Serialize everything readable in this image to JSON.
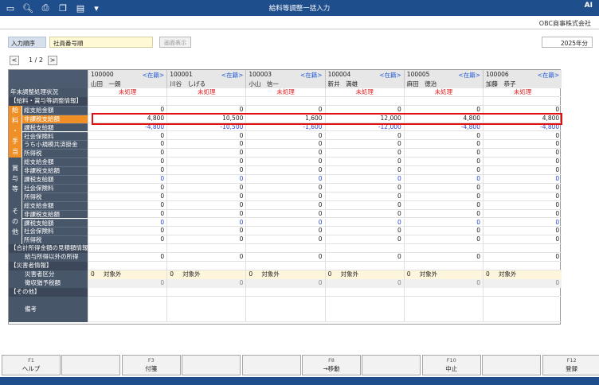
{
  "window": {
    "title": "給料等調整一括入力",
    "logo": "AI"
  },
  "company": "OBC商事株式会社",
  "filter": {
    "order_label": "入力順序",
    "order_value": "社員番号順",
    "display_button": "画面表示",
    "year": "2025年分"
  },
  "pager": {
    "prev": "<",
    "next": ">",
    "page": "1 / 2"
  },
  "employees": [
    {
      "code": "100000",
      "name": "山田　一朗",
      "status": "<在籍>"
    },
    {
      "code": "100001",
      "name": "川谷　しげる",
      "status": "<在籍>"
    },
    {
      "code": "100003",
      "name": "小山　信一",
      "status": "<在籍>"
    },
    {
      "code": "100004",
      "name": "新井　満雄",
      "status": "<在籍>"
    },
    {
      "code": "100005",
      "name": "麻田　徳治",
      "status": "<在籍>"
    },
    {
      "code": "100006",
      "name": "加藤　恭子",
      "status": "<在籍>"
    }
  ],
  "groups": {
    "kyuyo": [
      "給",
      "料",
      "・",
      "手",
      "当",
      "等"
    ],
    "shoyo": [
      "賞",
      "与",
      "等"
    ],
    "sonota": [
      "そ",
      "の",
      "他"
    ]
  },
  "rows": [
    {
      "label": "年末調整処理状況",
      "type": "status",
      "values": [
        "未処理",
        "未処理",
        "未処理",
        "未処理",
        "未処理",
        "未処理"
      ]
    },
    {
      "label": "【給料・賞与等調整情報】",
      "type": "section",
      "values": [
        "",
        "",
        "",
        "",
        "",
        ""
      ]
    },
    {
      "label": "総支給金額",
      "type": "kyuyo",
      "values": [
        "0",
        "0",
        "0",
        "0",
        "0",
        "0"
      ]
    },
    {
      "label": "非課税支給額",
      "type": "kyuyo-hl",
      "values": [
        "4,800",
        "10,500",
        "1,600",
        "12,000",
        "4,800",
        "4,800"
      ]
    },
    {
      "label": "課税支給額",
      "type": "kyuyo-neg",
      "values": [
        "-4,800",
        "-10,500",
        "-1,600",
        "-12,000",
        "-4,800",
        "-4,800"
      ]
    },
    {
      "label": "社会保険料",
      "type": "kyuyo",
      "values": [
        "0",
        "0",
        "0",
        "0",
        "0",
        "0"
      ]
    },
    {
      "label": "うち小規模共済掛金",
      "type": "kyuyo",
      "values": [
        "0",
        "0",
        "0",
        "0",
        "0",
        "0"
      ]
    },
    {
      "label": "所得税",
      "type": "kyuyo",
      "values": [
        "0",
        "0",
        "0",
        "0",
        "0",
        "0"
      ]
    },
    {
      "label": "総支給金額",
      "type": "shoyo",
      "values": [
        "0",
        "0",
        "0",
        "0",
        "0",
        "0"
      ]
    },
    {
      "label": "非課税支給額",
      "type": "shoyo",
      "values": [
        "0",
        "0",
        "0",
        "0",
        "0",
        "0"
      ]
    },
    {
      "label": "課税支給額",
      "type": "shoyo-blue",
      "values": [
        "0",
        "0",
        "0",
        "0",
        "0",
        "0"
      ]
    },
    {
      "label": "社会保険料",
      "type": "shoyo",
      "values": [
        "0",
        "0",
        "0",
        "0",
        "0",
        "0"
      ]
    },
    {
      "label": "所得税",
      "type": "shoyo",
      "values": [
        "0",
        "0",
        "0",
        "0",
        "0",
        "0"
      ]
    },
    {
      "label": "総支給金額",
      "type": "sonota",
      "values": [
        "0",
        "0",
        "0",
        "0",
        "0",
        "0"
      ]
    },
    {
      "label": "非課税支給額",
      "type": "sonota",
      "values": [
        "0",
        "0",
        "0",
        "0",
        "0",
        "0"
      ]
    },
    {
      "label": "課税支給額",
      "type": "sonota-blue",
      "values": [
        "0",
        "0",
        "0",
        "0",
        "0",
        "0"
      ]
    },
    {
      "label": "社会保険料",
      "type": "sonota",
      "values": [
        "0",
        "0",
        "0",
        "0",
        "0",
        "0"
      ]
    },
    {
      "label": "所得税",
      "type": "sonota",
      "values": [
        "0",
        "0",
        "0",
        "0",
        "0",
        "0"
      ]
    },
    {
      "label": "【合計所得金額の見積額情報】",
      "type": "section",
      "values": [
        "",
        "",
        "",
        "",
        "",
        ""
      ]
    },
    {
      "label": "給与所得以外の所得",
      "type": "indent",
      "values": [
        "0",
        "0",
        "0",
        "0",
        "0",
        "0"
      ]
    },
    {
      "label": "【災害者情報】",
      "type": "section",
      "values": [
        "",
        "",
        "",
        "",
        "",
        ""
      ]
    },
    {
      "label": "災害者区分",
      "type": "disaster",
      "values": [
        "0",
        "0",
        "0",
        "0",
        "0",
        "0"
      ],
      "text": "対象外"
    },
    {
      "label": "徴収猶予税額",
      "type": "gray",
      "values": [
        "0",
        "0",
        "0",
        "0",
        "0",
        "0"
      ]
    },
    {
      "label": "【その他】",
      "type": "section",
      "values": [
        "",
        "",
        "",
        "",
        "",
        ""
      ]
    },
    {
      "label": "備考",
      "type": "memo",
      "values": [
        "",
        "",
        "",
        "",
        "",
        ""
      ]
    }
  ],
  "fkeys": [
    {
      "key": "F1",
      "label": "ヘルプ"
    },
    {
      "key": "",
      "label": ""
    },
    {
      "key": "F3",
      "label": "付箋"
    },
    {
      "key": "",
      "label": ""
    },
    {
      "key": "",
      "label": ""
    },
    {
      "key": "F8",
      "label": "→移動"
    },
    {
      "key": "",
      "label": ""
    },
    {
      "key": "F10",
      "label": "中止"
    },
    {
      "key": "",
      "label": ""
    },
    {
      "key": "F12",
      "label": "登録"
    }
  ]
}
